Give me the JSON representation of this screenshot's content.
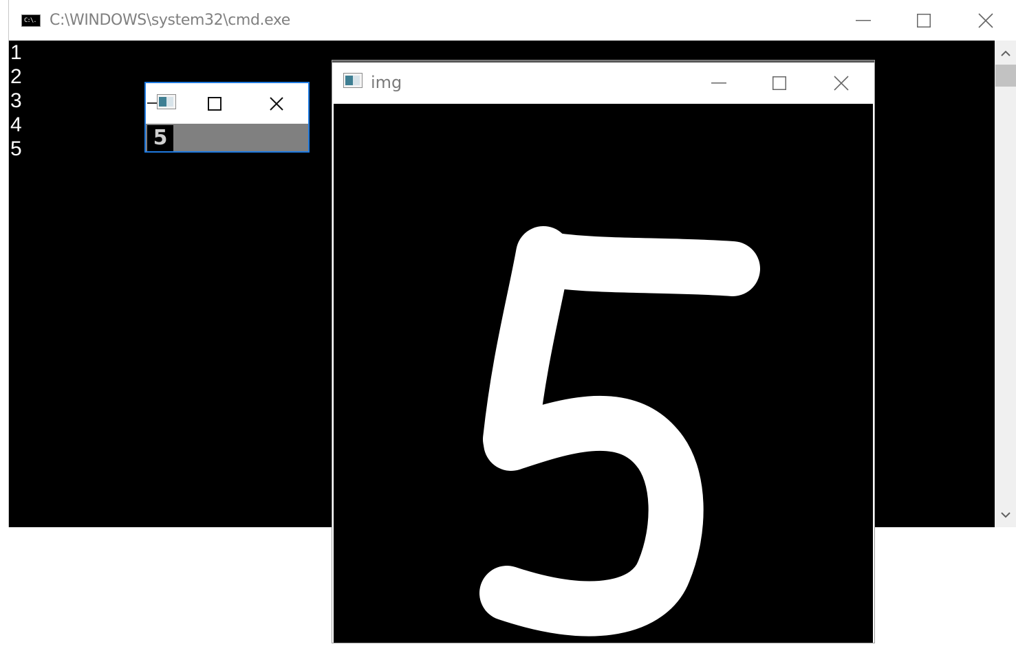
{
  "cmd_window": {
    "title": "C:\\WINDOWS\\system32\\cmd.exe",
    "icon": "cmd-icon",
    "icon_text": "C:\\.",
    "output_lines": [
      "1",
      "2",
      "3",
      "4",
      "5"
    ],
    "buttons": {
      "minimize": "minimize-icon",
      "maximize": "maximize-icon",
      "close": "close-icon"
    },
    "scrollbar": {
      "up": "chevron-up-icon",
      "down": "chevron-down-icon"
    }
  },
  "small_window": {
    "icon": "window-app-icon",
    "buttons": {
      "minimize": "minimize-icon",
      "maximize": "maximize-icon",
      "close": "close-icon"
    },
    "thumbnail_digit": "5"
  },
  "img_window": {
    "title": "img",
    "icon": "window-app-icon",
    "buttons": {
      "minimize": "minimize-icon",
      "maximize": "maximize-icon",
      "close": "close-icon"
    },
    "image": "handwritten-digit-5"
  },
  "colors": {
    "console_bg": "#000000",
    "console_text": "#ffffff",
    "active_border": "#1f7ae0",
    "titlebar_bg": "#ffffff",
    "title_text": "#808080"
  }
}
